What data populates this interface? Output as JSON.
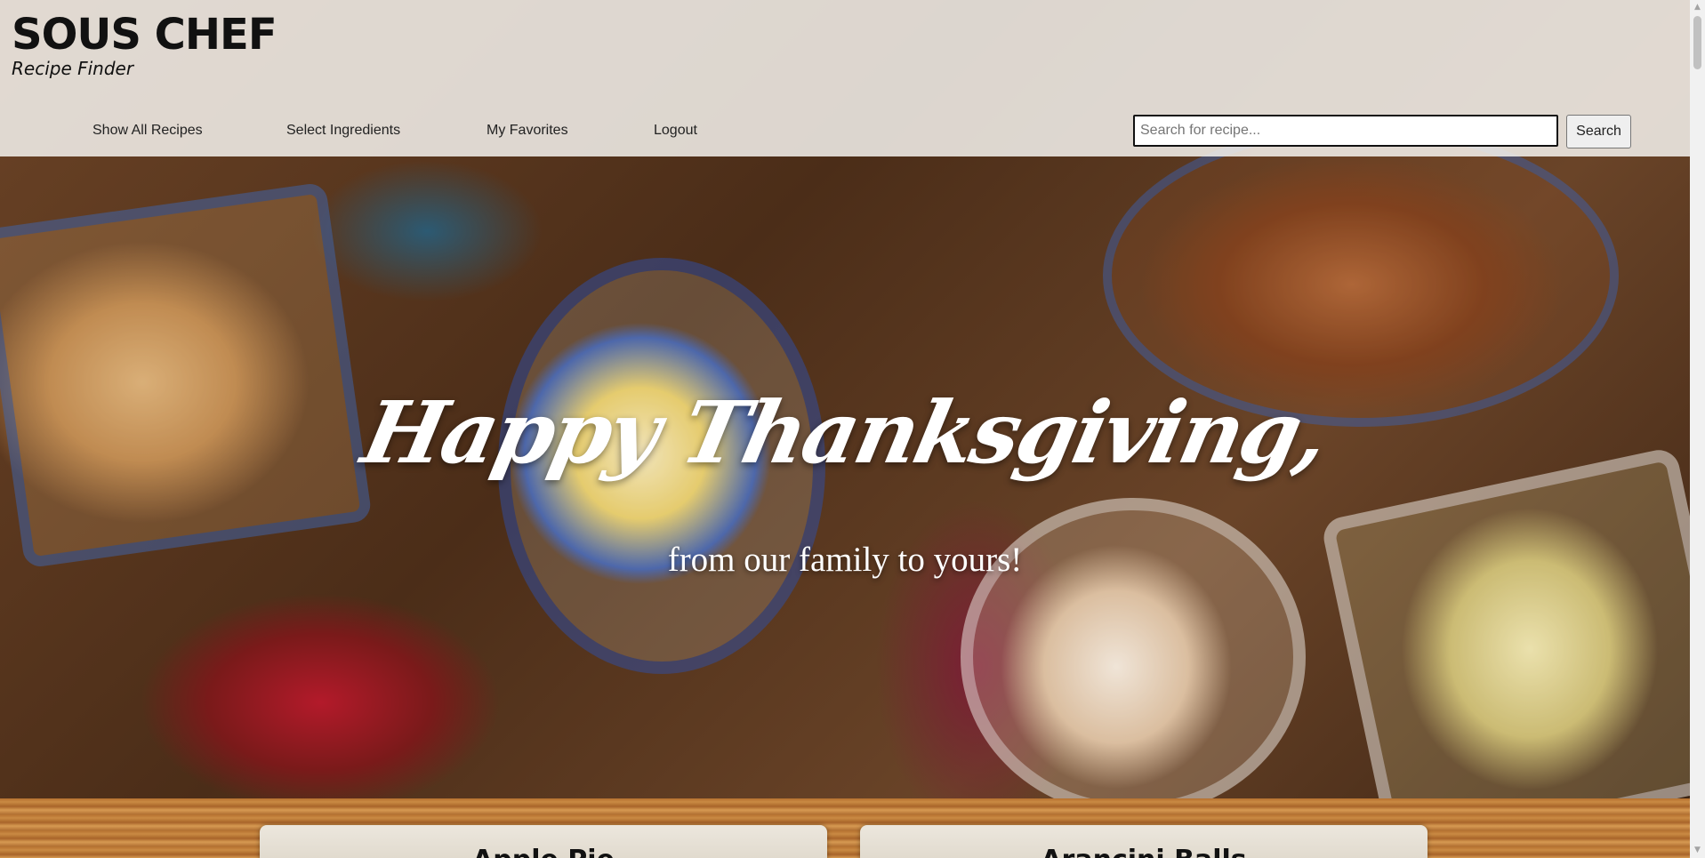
{
  "header": {
    "brand_name": "SOUS CHEF",
    "brand_tagline": "Recipe Finder",
    "nav": [
      {
        "label": "Show All Recipes"
      },
      {
        "label": "Select Ingredients"
      },
      {
        "label": "My Favorites"
      },
      {
        "label": "Logout"
      }
    ],
    "search": {
      "placeholder": "Search for recipe...",
      "value": "",
      "button_label": "Search"
    }
  },
  "hero": {
    "title": "Happy Thanksgiving,",
    "subtitle": "from our family to yours!"
  },
  "recipes": [
    {
      "title": "Apple Pie"
    },
    {
      "title": "Arancini Balls"
    }
  ]
}
